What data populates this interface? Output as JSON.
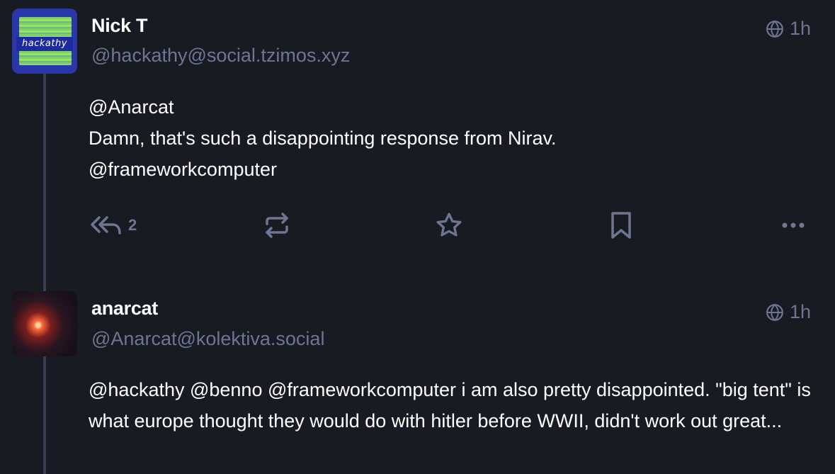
{
  "posts": [
    {
      "display_name": "Nick T",
      "handle": "@hackathy@social.tzimos.xyz",
      "time": "1h",
      "avatar_text": "hackathy",
      "content": [
        "@Anarcat",
        "Damn, that's such a disappointing response from Nirav.",
        "@frameworkcomputer"
      ],
      "reply_count": "2"
    },
    {
      "display_name": "anarcat",
      "handle": "@Anarcat@kolektiva.social",
      "time": "1h",
      "content": [
        "@hackathy @benno @frameworkcomputer  i am also pretty disappointed. \"big tent\" is what europe thought they would do with hitler before WWII, didn't work out great..."
      ]
    }
  ],
  "colors": {
    "background": "#191b22",
    "muted": "#6f7691",
    "text": "#ffffff",
    "thread_line": "#393f4f"
  },
  "icons": [
    "globe-icon",
    "reply-all-icon",
    "boost-icon",
    "star-icon",
    "bookmark-icon",
    "more-icon"
  ]
}
